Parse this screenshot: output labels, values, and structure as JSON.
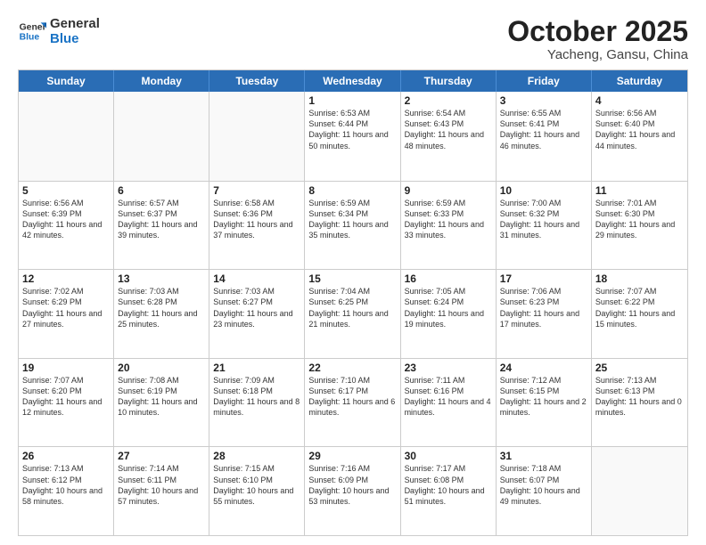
{
  "header": {
    "logo_general": "General",
    "logo_blue": "Blue",
    "month": "October 2025",
    "location": "Yacheng, Gansu, China"
  },
  "days_of_week": [
    "Sunday",
    "Monday",
    "Tuesday",
    "Wednesday",
    "Thursday",
    "Friday",
    "Saturday"
  ],
  "weeks": [
    [
      {
        "day": "",
        "info": "",
        "empty": true
      },
      {
        "day": "",
        "info": "",
        "empty": true
      },
      {
        "day": "",
        "info": "",
        "empty": true
      },
      {
        "day": "1",
        "info": "Sunrise: 6:53 AM\nSunset: 6:44 PM\nDaylight: 11 hours\nand 50 minutes.",
        "empty": false
      },
      {
        "day": "2",
        "info": "Sunrise: 6:54 AM\nSunset: 6:43 PM\nDaylight: 11 hours\nand 48 minutes.",
        "empty": false
      },
      {
        "day": "3",
        "info": "Sunrise: 6:55 AM\nSunset: 6:41 PM\nDaylight: 11 hours\nand 46 minutes.",
        "empty": false
      },
      {
        "day": "4",
        "info": "Sunrise: 6:56 AM\nSunset: 6:40 PM\nDaylight: 11 hours\nand 44 minutes.",
        "empty": false
      }
    ],
    [
      {
        "day": "5",
        "info": "Sunrise: 6:56 AM\nSunset: 6:39 PM\nDaylight: 11 hours\nand 42 minutes.",
        "empty": false
      },
      {
        "day": "6",
        "info": "Sunrise: 6:57 AM\nSunset: 6:37 PM\nDaylight: 11 hours\nand 39 minutes.",
        "empty": false
      },
      {
        "day": "7",
        "info": "Sunrise: 6:58 AM\nSunset: 6:36 PM\nDaylight: 11 hours\nand 37 minutes.",
        "empty": false
      },
      {
        "day": "8",
        "info": "Sunrise: 6:59 AM\nSunset: 6:34 PM\nDaylight: 11 hours\nand 35 minutes.",
        "empty": false
      },
      {
        "day": "9",
        "info": "Sunrise: 6:59 AM\nSunset: 6:33 PM\nDaylight: 11 hours\nand 33 minutes.",
        "empty": false
      },
      {
        "day": "10",
        "info": "Sunrise: 7:00 AM\nSunset: 6:32 PM\nDaylight: 11 hours\nand 31 minutes.",
        "empty": false
      },
      {
        "day": "11",
        "info": "Sunrise: 7:01 AM\nSunset: 6:30 PM\nDaylight: 11 hours\nand 29 minutes.",
        "empty": false
      }
    ],
    [
      {
        "day": "12",
        "info": "Sunrise: 7:02 AM\nSunset: 6:29 PM\nDaylight: 11 hours\nand 27 minutes.",
        "empty": false
      },
      {
        "day": "13",
        "info": "Sunrise: 7:03 AM\nSunset: 6:28 PM\nDaylight: 11 hours\nand 25 minutes.",
        "empty": false
      },
      {
        "day": "14",
        "info": "Sunrise: 7:03 AM\nSunset: 6:27 PM\nDaylight: 11 hours\nand 23 minutes.",
        "empty": false
      },
      {
        "day": "15",
        "info": "Sunrise: 7:04 AM\nSunset: 6:25 PM\nDaylight: 11 hours\nand 21 minutes.",
        "empty": false
      },
      {
        "day": "16",
        "info": "Sunrise: 7:05 AM\nSunset: 6:24 PM\nDaylight: 11 hours\nand 19 minutes.",
        "empty": false
      },
      {
        "day": "17",
        "info": "Sunrise: 7:06 AM\nSunset: 6:23 PM\nDaylight: 11 hours\nand 17 minutes.",
        "empty": false
      },
      {
        "day": "18",
        "info": "Sunrise: 7:07 AM\nSunset: 6:22 PM\nDaylight: 11 hours\nand 15 minutes.",
        "empty": false
      }
    ],
    [
      {
        "day": "19",
        "info": "Sunrise: 7:07 AM\nSunset: 6:20 PM\nDaylight: 11 hours\nand 12 minutes.",
        "empty": false
      },
      {
        "day": "20",
        "info": "Sunrise: 7:08 AM\nSunset: 6:19 PM\nDaylight: 11 hours\nand 10 minutes.",
        "empty": false
      },
      {
        "day": "21",
        "info": "Sunrise: 7:09 AM\nSunset: 6:18 PM\nDaylight: 11 hours\nand 8 minutes.",
        "empty": false
      },
      {
        "day": "22",
        "info": "Sunrise: 7:10 AM\nSunset: 6:17 PM\nDaylight: 11 hours\nand 6 minutes.",
        "empty": false
      },
      {
        "day": "23",
        "info": "Sunrise: 7:11 AM\nSunset: 6:16 PM\nDaylight: 11 hours\nand 4 minutes.",
        "empty": false
      },
      {
        "day": "24",
        "info": "Sunrise: 7:12 AM\nSunset: 6:15 PM\nDaylight: 11 hours\nand 2 minutes.",
        "empty": false
      },
      {
        "day": "25",
        "info": "Sunrise: 7:13 AM\nSunset: 6:13 PM\nDaylight: 11 hours\nand 0 minutes.",
        "empty": false
      }
    ],
    [
      {
        "day": "26",
        "info": "Sunrise: 7:13 AM\nSunset: 6:12 PM\nDaylight: 10 hours\nand 58 minutes.",
        "empty": false
      },
      {
        "day": "27",
        "info": "Sunrise: 7:14 AM\nSunset: 6:11 PM\nDaylight: 10 hours\nand 57 minutes.",
        "empty": false
      },
      {
        "day": "28",
        "info": "Sunrise: 7:15 AM\nSunset: 6:10 PM\nDaylight: 10 hours\nand 55 minutes.",
        "empty": false
      },
      {
        "day": "29",
        "info": "Sunrise: 7:16 AM\nSunset: 6:09 PM\nDaylight: 10 hours\nand 53 minutes.",
        "empty": false
      },
      {
        "day": "30",
        "info": "Sunrise: 7:17 AM\nSunset: 6:08 PM\nDaylight: 10 hours\nand 51 minutes.",
        "empty": false
      },
      {
        "day": "31",
        "info": "Sunrise: 7:18 AM\nSunset: 6:07 PM\nDaylight: 10 hours\nand 49 minutes.",
        "empty": false
      },
      {
        "day": "",
        "info": "",
        "empty": true
      }
    ]
  ]
}
